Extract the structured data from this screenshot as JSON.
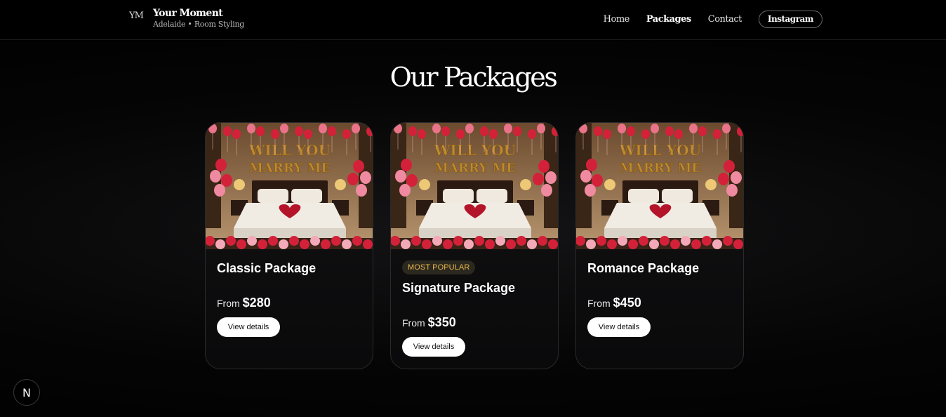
{
  "header": {
    "logo_mark": "YM",
    "brand_title": "Your Moment",
    "brand_subtitle": "Adelaide • Room Styling",
    "nav": [
      {
        "label": "Home",
        "active": false
      },
      {
        "label": "Packages",
        "active": true
      },
      {
        "label": "Contact",
        "active": false
      }
    ],
    "instagram_label": "Instagram"
  },
  "main": {
    "title": "Our Packages",
    "packages": [
      {
        "name": "Classic Package",
        "price_prefix": "From",
        "price": "$280",
        "badge": "",
        "button": "View details",
        "image_text": [
          "WILL YOU",
          "MARRY ME"
        ]
      },
      {
        "name": "Signature Package",
        "price_prefix": "From",
        "price": "$350",
        "badge": "MOST POPULAR",
        "button": "View details",
        "image_text": [
          "WILL YOU",
          "MARRY ME"
        ]
      },
      {
        "name": "Romance Package",
        "price_prefix": "From",
        "price": "$450",
        "badge": "",
        "button": "View details",
        "image_text": [
          "WILL YOU",
          "MARRY ME"
        ]
      }
    ]
  },
  "corner_badge": "N",
  "colors": {
    "background": "#000000",
    "card": "#121214",
    "badge_bg": "#2b2820",
    "badge_text": "#e8b84a",
    "balloon_red": "#d4213a",
    "balloon_gold": "#c08a2e"
  }
}
